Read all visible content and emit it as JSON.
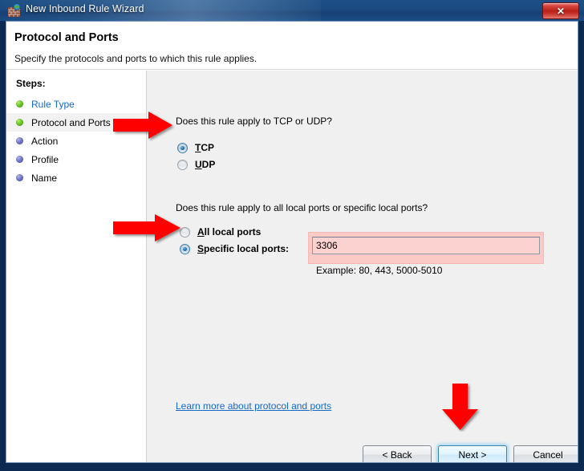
{
  "window": {
    "title": "New Inbound Rule Wizard",
    "icon": "firewall-icon",
    "close_label": "✕"
  },
  "header": {
    "title": "Protocol and Ports",
    "subtitle": "Specify the protocols and ports to which this rule applies."
  },
  "sidebar": {
    "heading": "Steps:",
    "items": [
      {
        "label": "Rule Type",
        "state": "done",
        "link": true,
        "current": false
      },
      {
        "label": "Protocol and Ports",
        "state": "done",
        "link": false,
        "current": true
      },
      {
        "label": "Action",
        "state": "pending",
        "link": false,
        "current": false
      },
      {
        "label": "Profile",
        "state": "pending",
        "link": false,
        "current": false
      },
      {
        "label": "Name",
        "state": "pending",
        "link": false,
        "current": false
      }
    ]
  },
  "content": {
    "protocol_question": "Does this rule apply to TCP or UDP?",
    "protocol_options": [
      {
        "label": "TCP",
        "accel": "T",
        "checked": true
      },
      {
        "label": "UDP",
        "accel": "U",
        "checked": false
      }
    ],
    "ports_question": "Does this rule apply to all local ports or specific local ports?",
    "ports_options": [
      {
        "label": "All local ports",
        "accel": "A",
        "checked": false
      },
      {
        "label": "Specific local ports:",
        "accel": "S",
        "checked": true
      }
    ],
    "port_value": "3306",
    "port_placeholder": "",
    "port_example": "Example: 80, 443, 5000-5010",
    "learn_more": "Learn more about protocol and ports"
  },
  "footer": {
    "back_label": "< Back",
    "next_label": "Next >",
    "cancel_label": "Cancel"
  },
  "annotations": {
    "arrow_color": "#fe0000",
    "highlight_color": "#fbc9c6",
    "link_color": "#1269c7"
  }
}
